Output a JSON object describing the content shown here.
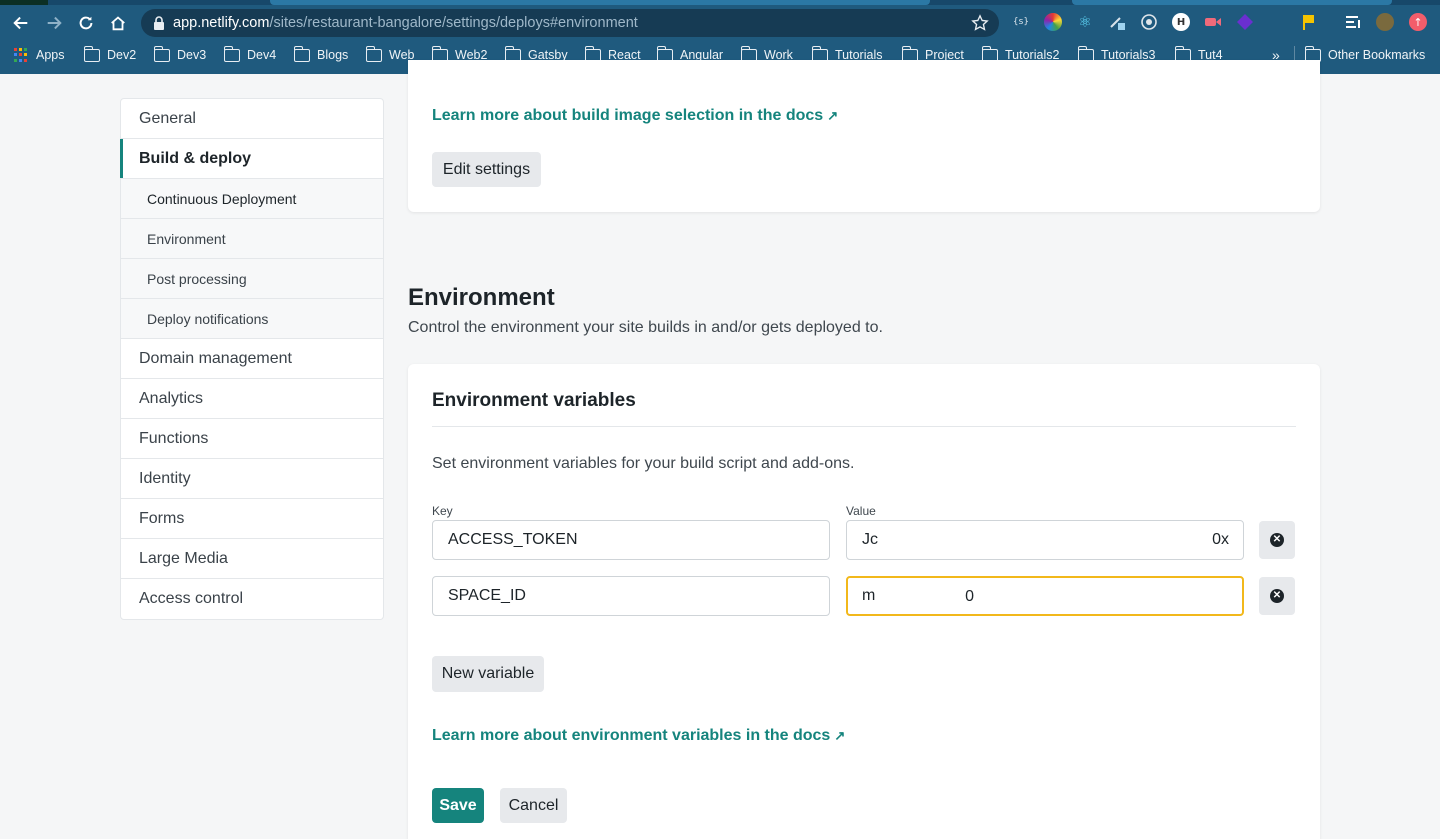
{
  "browser": {
    "url_host": "app.netlify.com",
    "url_path": "/sites/restaurant-bangalore/settings/deploys#environment",
    "bookmarks": [
      "Apps",
      "Dev2",
      "Dev3",
      "Dev4",
      "Blogs",
      "Web",
      "Web2",
      "Gatsby",
      "React",
      "Angular",
      "Work",
      "Tutorials",
      "Project",
      "Tutorials2",
      "Tutorials3",
      "Tut4"
    ],
    "overflow": "»",
    "other_bookmarks": "Other Bookmarks"
  },
  "sidebar": {
    "general": "General",
    "build_deploy": "Build & deploy",
    "sub": {
      "continuous_deployment": "Continuous Deployment",
      "environment": "Environment",
      "post_processing": "Post processing",
      "deploy_notifications": "Deploy notifications"
    },
    "domain_management": "Domain management",
    "analytics": "Analytics",
    "functions": "Functions",
    "identity": "Identity",
    "forms": "Forms",
    "large_media": "Large Media",
    "access_control": "Access control"
  },
  "build_image": {
    "docs_link": "Learn more about build image selection in the docs",
    "edit_button": "Edit settings"
  },
  "environment": {
    "title": "Environment",
    "description": "Control the environment your site builds in and/or gets deployed to.",
    "card_title": "Environment variables",
    "card_description": "Set environment variables for your build script and add-ons.",
    "key_label": "Key",
    "value_label": "Value",
    "variables": [
      {
        "key": "ACCESS_TOKEN",
        "value_start": "Jc",
        "value_end": "0x"
      },
      {
        "key": "SPACE_ID",
        "value_start": "m",
        "value_end": "0"
      }
    ],
    "new_variable_button": "New variable",
    "docs_link": "Learn more about environment variables in the docs",
    "save_button": "Save",
    "cancel_button": "Cancel"
  },
  "colors": {
    "accent": "#15847d",
    "focus_border": "#f2b81b",
    "chrome_bg": "#1f5a7e"
  }
}
